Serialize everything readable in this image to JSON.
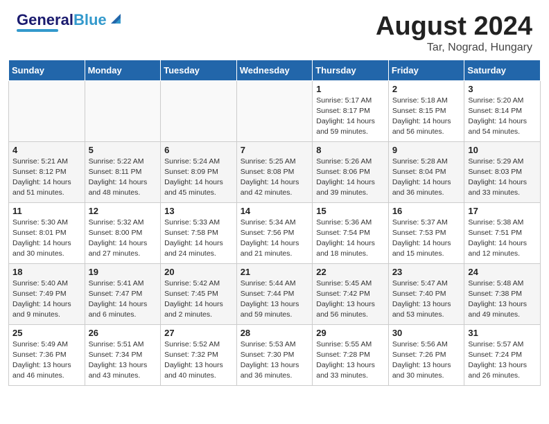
{
  "header": {
    "logo_general": "General",
    "logo_blue": "Blue",
    "month": "August 2024",
    "location": "Tar, Nograd, Hungary"
  },
  "weekdays": [
    "Sunday",
    "Monday",
    "Tuesday",
    "Wednesday",
    "Thursday",
    "Friday",
    "Saturday"
  ],
  "weeks": [
    [
      {
        "day": "",
        "info": ""
      },
      {
        "day": "",
        "info": ""
      },
      {
        "day": "",
        "info": ""
      },
      {
        "day": "",
        "info": ""
      },
      {
        "day": "1",
        "info": "Sunrise: 5:17 AM\nSunset: 8:17 PM\nDaylight: 14 hours\nand 59 minutes."
      },
      {
        "day": "2",
        "info": "Sunrise: 5:18 AM\nSunset: 8:15 PM\nDaylight: 14 hours\nand 56 minutes."
      },
      {
        "day": "3",
        "info": "Sunrise: 5:20 AM\nSunset: 8:14 PM\nDaylight: 14 hours\nand 54 minutes."
      }
    ],
    [
      {
        "day": "4",
        "info": "Sunrise: 5:21 AM\nSunset: 8:12 PM\nDaylight: 14 hours\nand 51 minutes."
      },
      {
        "day": "5",
        "info": "Sunrise: 5:22 AM\nSunset: 8:11 PM\nDaylight: 14 hours\nand 48 minutes."
      },
      {
        "day": "6",
        "info": "Sunrise: 5:24 AM\nSunset: 8:09 PM\nDaylight: 14 hours\nand 45 minutes."
      },
      {
        "day": "7",
        "info": "Sunrise: 5:25 AM\nSunset: 8:08 PM\nDaylight: 14 hours\nand 42 minutes."
      },
      {
        "day": "8",
        "info": "Sunrise: 5:26 AM\nSunset: 8:06 PM\nDaylight: 14 hours\nand 39 minutes."
      },
      {
        "day": "9",
        "info": "Sunrise: 5:28 AM\nSunset: 8:04 PM\nDaylight: 14 hours\nand 36 minutes."
      },
      {
        "day": "10",
        "info": "Sunrise: 5:29 AM\nSunset: 8:03 PM\nDaylight: 14 hours\nand 33 minutes."
      }
    ],
    [
      {
        "day": "11",
        "info": "Sunrise: 5:30 AM\nSunset: 8:01 PM\nDaylight: 14 hours\nand 30 minutes."
      },
      {
        "day": "12",
        "info": "Sunrise: 5:32 AM\nSunset: 8:00 PM\nDaylight: 14 hours\nand 27 minutes."
      },
      {
        "day": "13",
        "info": "Sunrise: 5:33 AM\nSunset: 7:58 PM\nDaylight: 14 hours\nand 24 minutes."
      },
      {
        "day": "14",
        "info": "Sunrise: 5:34 AM\nSunset: 7:56 PM\nDaylight: 14 hours\nand 21 minutes."
      },
      {
        "day": "15",
        "info": "Sunrise: 5:36 AM\nSunset: 7:54 PM\nDaylight: 14 hours\nand 18 minutes."
      },
      {
        "day": "16",
        "info": "Sunrise: 5:37 AM\nSunset: 7:53 PM\nDaylight: 14 hours\nand 15 minutes."
      },
      {
        "day": "17",
        "info": "Sunrise: 5:38 AM\nSunset: 7:51 PM\nDaylight: 14 hours\nand 12 minutes."
      }
    ],
    [
      {
        "day": "18",
        "info": "Sunrise: 5:40 AM\nSunset: 7:49 PM\nDaylight: 14 hours\nand 9 minutes."
      },
      {
        "day": "19",
        "info": "Sunrise: 5:41 AM\nSunset: 7:47 PM\nDaylight: 14 hours\nand 6 minutes."
      },
      {
        "day": "20",
        "info": "Sunrise: 5:42 AM\nSunset: 7:45 PM\nDaylight: 14 hours\nand 2 minutes."
      },
      {
        "day": "21",
        "info": "Sunrise: 5:44 AM\nSunset: 7:44 PM\nDaylight: 13 hours\nand 59 minutes."
      },
      {
        "day": "22",
        "info": "Sunrise: 5:45 AM\nSunset: 7:42 PM\nDaylight: 13 hours\nand 56 minutes."
      },
      {
        "day": "23",
        "info": "Sunrise: 5:47 AM\nSunset: 7:40 PM\nDaylight: 13 hours\nand 53 minutes."
      },
      {
        "day": "24",
        "info": "Sunrise: 5:48 AM\nSunset: 7:38 PM\nDaylight: 13 hours\nand 49 minutes."
      }
    ],
    [
      {
        "day": "25",
        "info": "Sunrise: 5:49 AM\nSunset: 7:36 PM\nDaylight: 13 hours\nand 46 minutes."
      },
      {
        "day": "26",
        "info": "Sunrise: 5:51 AM\nSunset: 7:34 PM\nDaylight: 13 hours\nand 43 minutes."
      },
      {
        "day": "27",
        "info": "Sunrise: 5:52 AM\nSunset: 7:32 PM\nDaylight: 13 hours\nand 40 minutes."
      },
      {
        "day": "28",
        "info": "Sunrise: 5:53 AM\nSunset: 7:30 PM\nDaylight: 13 hours\nand 36 minutes."
      },
      {
        "day": "29",
        "info": "Sunrise: 5:55 AM\nSunset: 7:28 PM\nDaylight: 13 hours\nand 33 minutes."
      },
      {
        "day": "30",
        "info": "Sunrise: 5:56 AM\nSunset: 7:26 PM\nDaylight: 13 hours\nand 30 minutes."
      },
      {
        "day": "31",
        "info": "Sunrise: 5:57 AM\nSunset: 7:24 PM\nDaylight: 13 hours\nand 26 minutes."
      }
    ]
  ]
}
